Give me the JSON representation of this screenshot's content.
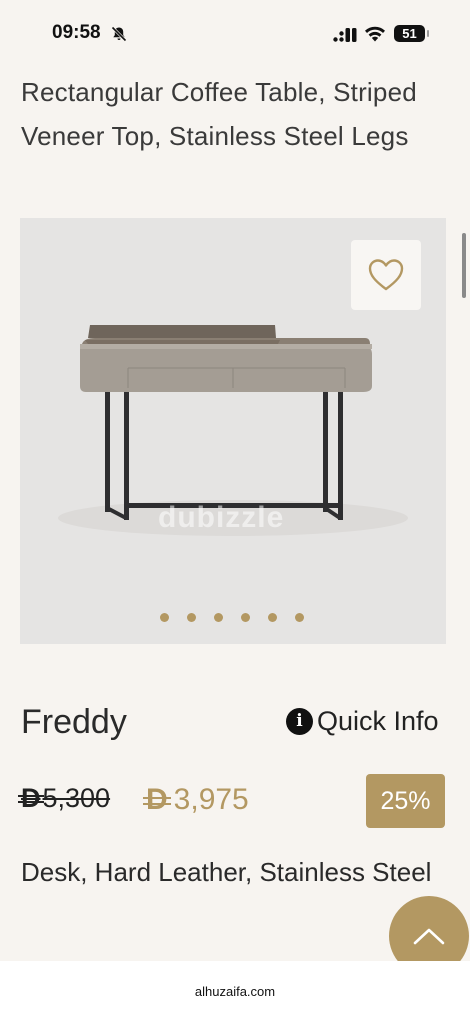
{
  "status_bar": {
    "time": "09:58",
    "battery": "51"
  },
  "product": {
    "title": "Rectangular Coffee Table, Striped Veneer Top, Stainless Steel Legs",
    "brand": "Freddy",
    "quick_info_label": "Quick Info",
    "old_price": "5,300",
    "new_price": "3,975",
    "currency_symbol": "D",
    "discount": "25%",
    "description": "Desk, Hard Leather, Stainless Steel",
    "image_watermark": "dubizzle",
    "gallery_image_count": 6
  },
  "browser": {
    "url": "alhuzaifa.com"
  },
  "colors": {
    "accent": "#b39862",
    "background": "#f7f4f0",
    "gallery_bg": "#e5e4e3"
  },
  "icons": {
    "wishlist": "heart-icon",
    "info": "info-icon",
    "scroll_top": "chevron-up-icon"
  }
}
